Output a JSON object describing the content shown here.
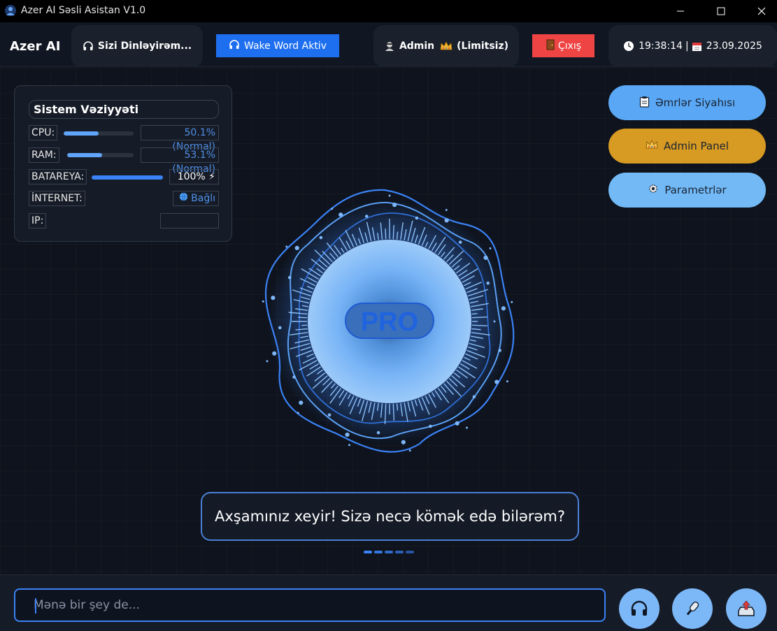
{
  "window": {
    "title": "Azer AI Səsli Asistan V1.0"
  },
  "topbar": {
    "brand": "Azer AI",
    "listening_label": "Sizi Dinləyirəm...",
    "wake_word_label": "Wake Word Aktiv",
    "user_label": "Admin",
    "user_suffix": "(Limitsiz)",
    "exit_label": "Çıxış",
    "time": "19:38:14",
    "separator": "|",
    "date": "23.09.2025"
  },
  "system": {
    "title": "Sistem Vəziyyəti",
    "cpu": {
      "label": "CPU:",
      "value": "50.1% (Normal)",
      "percent": 50.1
    },
    "ram": {
      "label": "RAM:",
      "value": "53.1% (Normal)",
      "percent": 53.1
    },
    "battery": {
      "label": "BATAREYA:",
      "value": "100% ⚡",
      "percent": 100
    },
    "internet": {
      "label": "İNTERNET:",
      "value": "Bağlı"
    },
    "ip": {
      "label": "IP:",
      "value": ""
    }
  },
  "side_buttons": {
    "commands": "Əmrlər Siyahısı",
    "admin_panel": "Admin Panel",
    "settings": "Parametrlər"
  },
  "orb": {
    "label": "PRO"
  },
  "message": "Axşamınız xeyir! Sizə necə kömək edə bilərəm?",
  "input": {
    "placeholder": "Mənə bir şey de...",
    "value": ""
  },
  "colors": {
    "accent": "#3b82f6",
    "danger": "#ef4444",
    "gold": "#d79a22",
    "background": "#0e131d"
  },
  "icons": {
    "listening": "headphones-icon",
    "wake_word": "headphones-icon",
    "user": "user-icon",
    "crown": "crown-icon",
    "exit": "door-icon",
    "clock": "clock-icon",
    "calendar": "calendar-icon",
    "commands": "clipboard-icon",
    "admin": "crown-icon",
    "settings": "gear-icon",
    "headset_button": "headphones-icon",
    "mic_button": "microphone-icon",
    "upload_button": "upload-icon"
  }
}
